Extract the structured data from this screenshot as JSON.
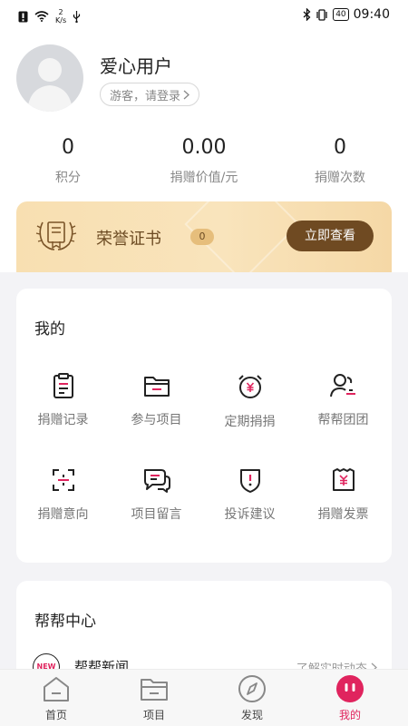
{
  "status_bar": {
    "speed_value": "2",
    "speed_unit": "K/s",
    "battery": "40",
    "time": "09:40"
  },
  "profile": {
    "username": "爱心用户",
    "login_prompt": "游客，请登录"
  },
  "stats": [
    {
      "value": "0",
      "label": "积分"
    },
    {
      "value": "0.00",
      "label": "捐赠价值/元"
    },
    {
      "value": "0",
      "label": "捐赠次数"
    }
  ],
  "honor": {
    "title": "荣誉证书",
    "count": "0",
    "button": "立即查看"
  },
  "mine": {
    "title": "我的",
    "items": [
      {
        "label": "捐赠记录",
        "icon": "clipboard-icon"
      },
      {
        "label": "参与项目",
        "icon": "folder-icon"
      },
      {
        "label": "定期捐捐",
        "icon": "alarm-clock-icon"
      },
      {
        "label": "帮帮团团",
        "icon": "group-icon"
      },
      {
        "label": "捐赠意向",
        "icon": "scan-target-icon"
      },
      {
        "label": "项目留言",
        "icon": "chat-bubbles-icon"
      },
      {
        "label": "投诉建议",
        "icon": "shield-alert-icon"
      },
      {
        "label": "捐赠发票",
        "icon": "invoice-icon"
      }
    ]
  },
  "help_center": {
    "title": "帮帮中心",
    "news_badge": "NEW",
    "news_title": "帮帮新闻",
    "news_link": "了解实时动态"
  },
  "tabs": [
    {
      "label": "首页",
      "icon": "home-icon",
      "active": false
    },
    {
      "label": "项目",
      "icon": "folder-icon",
      "active": false
    },
    {
      "label": "发现",
      "icon": "compass-icon",
      "active": false
    },
    {
      "label": "我的",
      "icon": "profile-face-icon",
      "active": true
    }
  ],
  "colors": {
    "accent": "#e0245e",
    "honor_button": "#6f4a22",
    "honor_bg": "#f9e4bc"
  }
}
